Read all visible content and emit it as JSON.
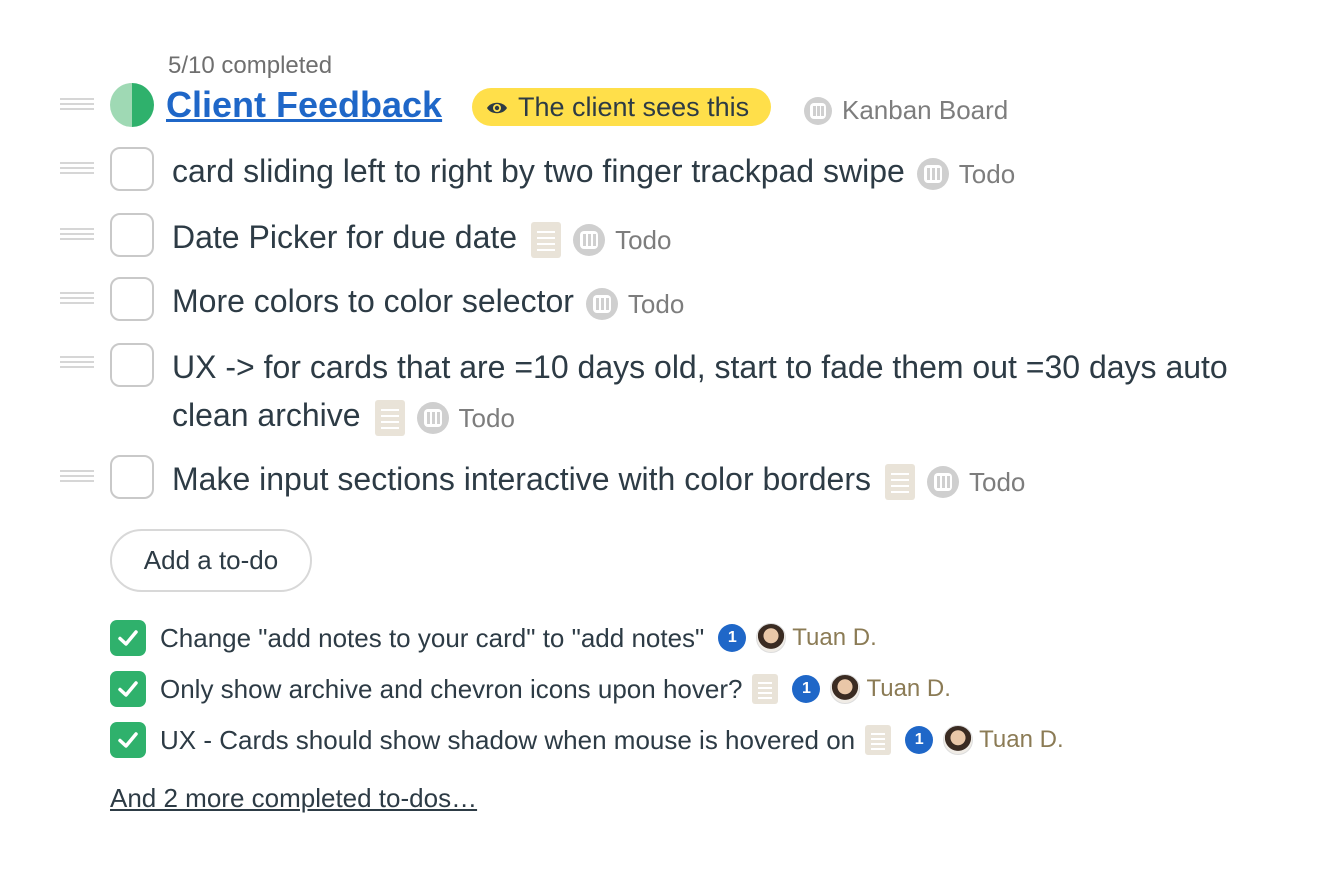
{
  "header": {
    "progress_text": "5/10 completed",
    "progress_fraction": 0.5,
    "title": "Client Feedback",
    "client_badge": "The client sees this",
    "bucket": "Kanban Board"
  },
  "todos": [
    {
      "text": "card sliding left to right by two finger trackpad swipe",
      "bucket": "Todo",
      "has_notes": false
    },
    {
      "text": "Date Picker for due date",
      "bucket": "Todo",
      "has_notes": true
    },
    {
      "text": "More colors to color selector",
      "bucket": "Todo",
      "has_notes": false
    },
    {
      "text": "UX -> for cards that are =10 days old, start to fade them out =30 days auto clean archive",
      "bucket": "Todo",
      "has_notes": true
    },
    {
      "text": "Make input sections interactive with color borders",
      "bucket": "Todo",
      "has_notes": true
    }
  ],
  "add_button_label": "Add a to-do",
  "completed": [
    {
      "text": "Change \"add notes to your card\" to \"add notes\"",
      "comments": "1",
      "assignee": "Tuan D.",
      "has_notes": false
    },
    {
      "text": "Only show archive and chevron icons upon hover?",
      "comments": "1",
      "assignee": "Tuan D.",
      "has_notes": true
    },
    {
      "text": "UX - Cards should show shadow when mouse is hovered on",
      "comments": "1",
      "assignee": "Tuan D.",
      "has_notes": true
    }
  ],
  "more_completed_link": "And 2 more completed to-dos…",
  "colors": {
    "title_link": "#1f67c8",
    "client_badge_bg": "#ffdf4a",
    "progress_green": "#2fb16c",
    "progress_light": "#9fd9b4"
  }
}
